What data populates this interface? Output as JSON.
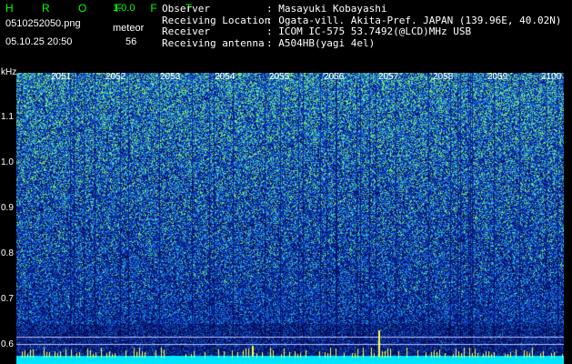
{
  "app": {
    "name": "H R O F F T",
    "version": "1.0.0"
  },
  "file": {
    "name": "0510252050.png",
    "mode": "meteor",
    "timestamp": "05.10.25 20:50",
    "count": "56"
  },
  "meta": [
    {
      "label": "Observer",
      "value": ": Masayuki Kobayashi"
    },
    {
      "label": "Receiving Location",
      "value": ": Ogata-vill. Akita-Pref. JAPAN (139.96E, 40.02N)"
    },
    {
      "label": "Receiver",
      "value": ": ICOM IC-575 53.7492(@LCD)MHz USB"
    },
    {
      "label": "Receiving antenna",
      "value": ": A504HB(yagi 4el)"
    }
  ],
  "axis": {
    "unit": "kHz",
    "y_labels": [
      "1.1",
      "1.0",
      "0.9",
      "0.8",
      "0.7",
      "0.6"
    ],
    "x_labels": [
      "2051",
      "2052",
      "2053",
      "2054",
      "2055",
      "2056",
      "2057",
      "2058",
      "2059",
      "2100"
    ]
  },
  "colors": {
    "title": "#00ff00",
    "text": "#ffffff",
    "bg": "#000000"
  }
}
